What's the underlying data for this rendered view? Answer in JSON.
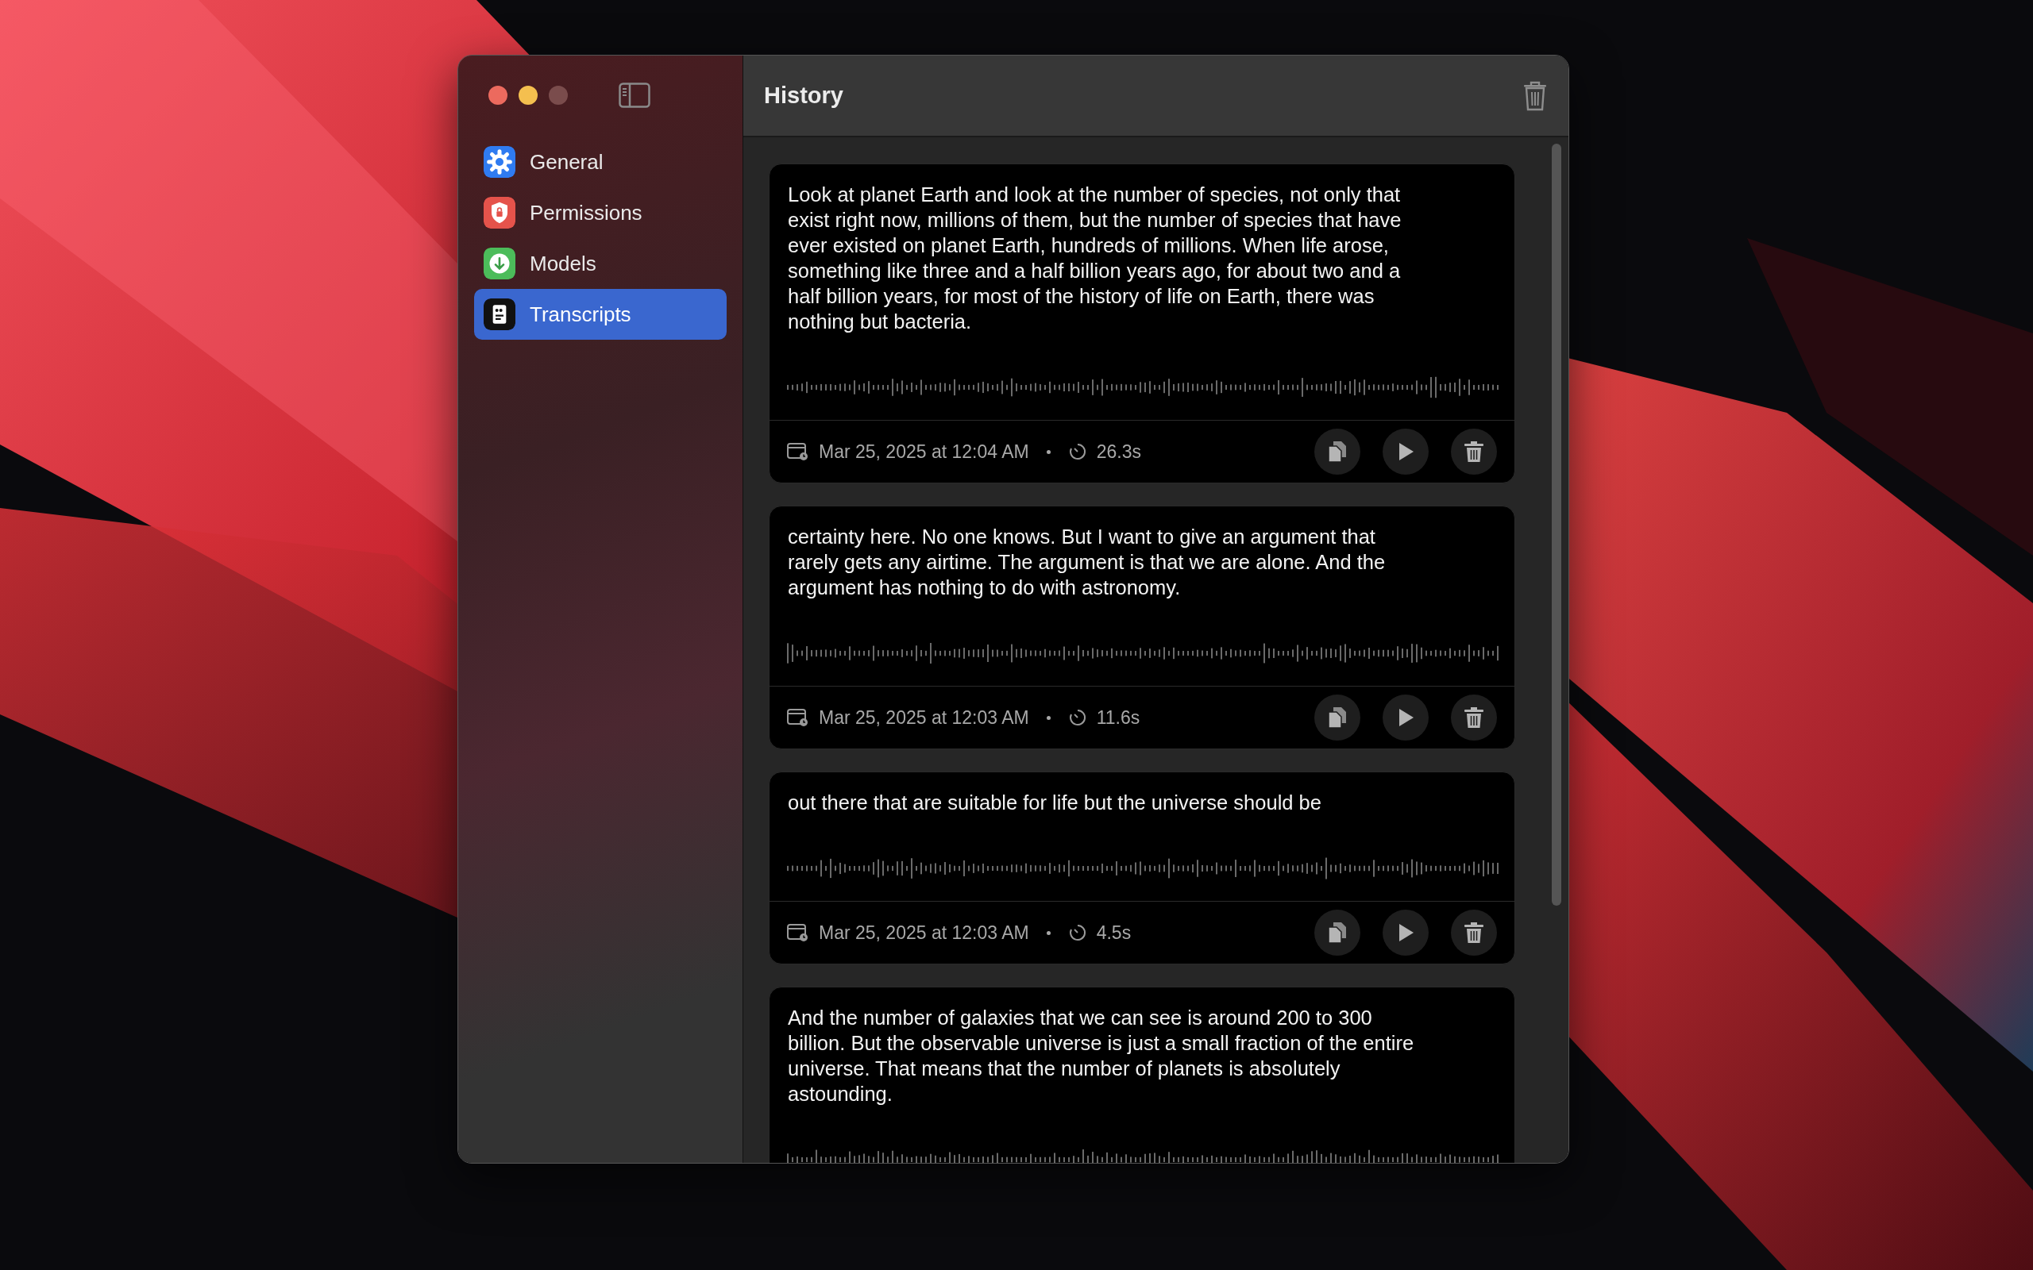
{
  "window": {
    "title": "History"
  },
  "sidebar": {
    "items": [
      {
        "label": "General",
        "kind": "gear",
        "color": "#2f7bf1",
        "selected": false
      },
      {
        "label": "Permissions",
        "kind": "shield",
        "color": "#e5534b",
        "selected": false
      },
      {
        "label": "Models",
        "kind": "download",
        "color": "#4cbc5a",
        "selected": false
      },
      {
        "label": "Transcripts",
        "kind": "transcript",
        "color": "#111111",
        "selected": true
      }
    ]
  },
  "transcripts": [
    {
      "text": "Look at planet Earth and look at the number of species, not only that exist right now, millions of them, but the number of species that have ever existed on planet Earth, hundreds of millions. When life arose, something like three and a half billion years ago, for about two and a half billion years, for most of the history of life on Earth, there was nothing but bacteria.",
      "date": "Mar 25, 2025 at 12:04 AM",
      "duration": "26.3s"
    },
    {
      "text": "certainty here. No one knows. But I want to give an argument that rarely gets any airtime. The argument is that we are alone. And the argument has nothing to do with astronomy.",
      "date": "Mar 25, 2025 at 12:03 AM",
      "duration": "11.6s"
    },
    {
      "text": "out there that are suitable for life but the universe should be",
      "date": "Mar 25, 2025 at 12:03 AM",
      "duration": "4.5s"
    },
    {
      "text": "And the number of galaxies that we can see is around 200 to 300 billion. But the observable universe is just a small fraction of the entire universe. That means that the number of planets is absolutely astounding."
    }
  ]
}
